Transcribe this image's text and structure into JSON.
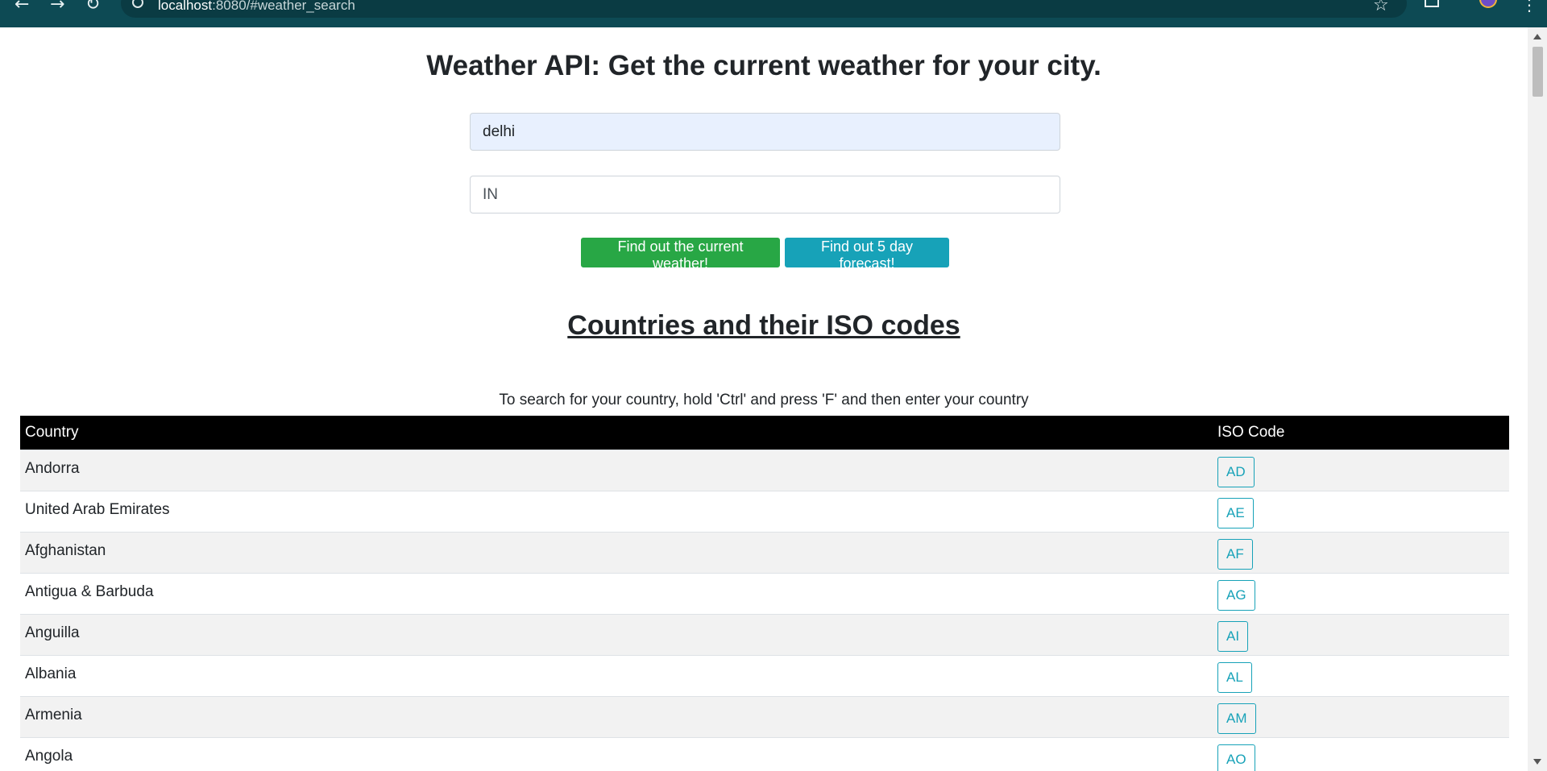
{
  "browser": {
    "url_host": "localhost",
    "url_rest": ":8080/#weather_search",
    "icons": [
      "back-icon",
      "forward-icon",
      "reload-icon",
      "info-icon",
      "star-icon",
      "extensions-icon",
      "avatar",
      "menu-icon"
    ]
  },
  "header": {
    "title": "Weather API: Get the current weather for your city."
  },
  "form": {
    "city_value": "delhi",
    "country_value": "IN",
    "current_button": "Find out the current weather!",
    "forecast_button": "Find out 5 day forecast!"
  },
  "countries_section": {
    "title": "Countries and their ISO codes",
    "hint": "To search for your country, hold 'Ctrl' and press 'F' and then enter your country",
    "columns": [
      "Country",
      "ISO Code"
    ],
    "rows": [
      {
        "country": "Andorra",
        "code": "AD"
      },
      {
        "country": "United Arab Emirates",
        "code": "AE"
      },
      {
        "country": "Afghanistan",
        "code": "AF"
      },
      {
        "country": "Antigua & Barbuda",
        "code": "AG"
      },
      {
        "country": "Anguilla",
        "code": "AI"
      },
      {
        "country": "Albania",
        "code": "AL"
      },
      {
        "country": "Armenia",
        "code": "AM"
      },
      {
        "country": "Angola",
        "code": "AO"
      }
    ]
  },
  "colors": {
    "browser_bar": "#0d4a54",
    "success": "#28a745",
    "info": "#17a2b8",
    "table_header": "#000000"
  }
}
